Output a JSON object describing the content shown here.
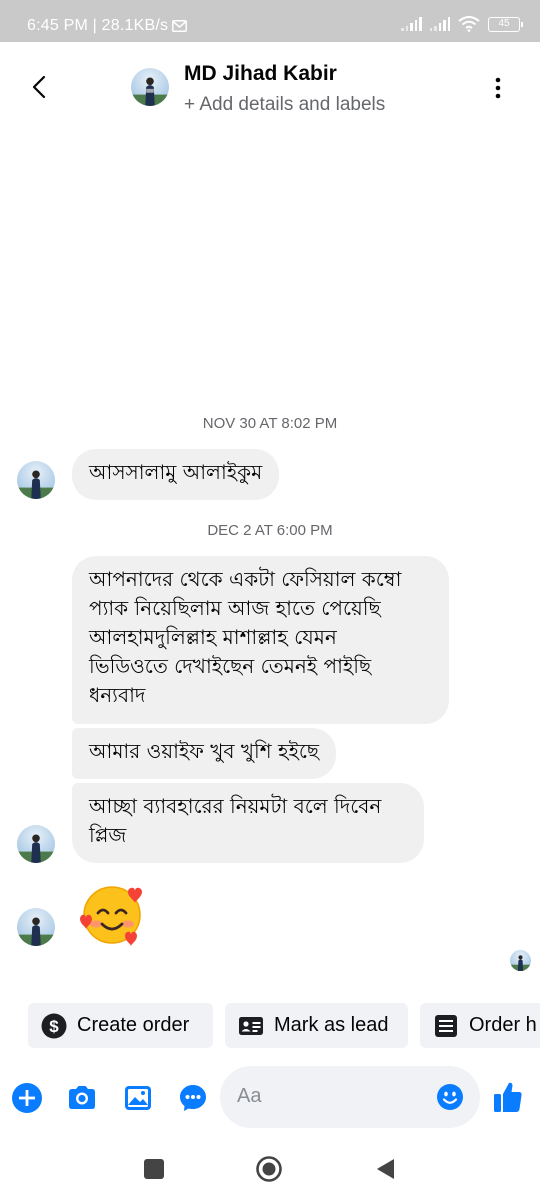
{
  "status_bar": {
    "time_speed": "6:45 PM | 28.1KB/s",
    "mail_icon": "gmail-icon",
    "battery": "45"
  },
  "header": {
    "contact_name": "MD Jihad Kabir",
    "subtitle": "+ Add details and labels"
  },
  "messages": [
    {
      "timestamp": "NOV 30 AT 8:02 PM"
    },
    {
      "text": "আসসালামু আলাইকুম"
    },
    {
      "timestamp": "DEC 2 AT 6:00 PM"
    },
    {
      "lines": [
        "আপনাদের থেকে একটা ফেসিয়াল কম্বো",
        "প্যাক নিয়েছিলাম আজ হাতে পেয়েছি",
        "আলহামদুলিল্লাহ মাশাল্লাহ যেমন",
        "ভিডিওতে দেখাইছেন তেমনই পাইছি",
        "ধন্যবাদ"
      ]
    },
    {
      "text": "আমার ওয়াইফ খুব খুশি হইছে"
    },
    {
      "lines": [
        "আচ্ছা ব্যাবহারের নিয়মটা বলে দিবেন",
        "প্লিজ"
      ]
    },
    {
      "emoji": "smiling-face-with-hearts"
    }
  ],
  "quick_actions": [
    {
      "label": "Create order",
      "icon": "dollar-icon"
    },
    {
      "label": "Mark as lead",
      "icon": "contact-card-icon"
    },
    {
      "label": "Order h",
      "icon": "order-list-icon"
    }
  ],
  "composer": {
    "placeholder": "Aa"
  },
  "colors": {
    "accent": "#0a7cff",
    "bubble": "#f0f0f0",
    "status_bar": "#c9c9c9",
    "muted": "#65676b"
  }
}
